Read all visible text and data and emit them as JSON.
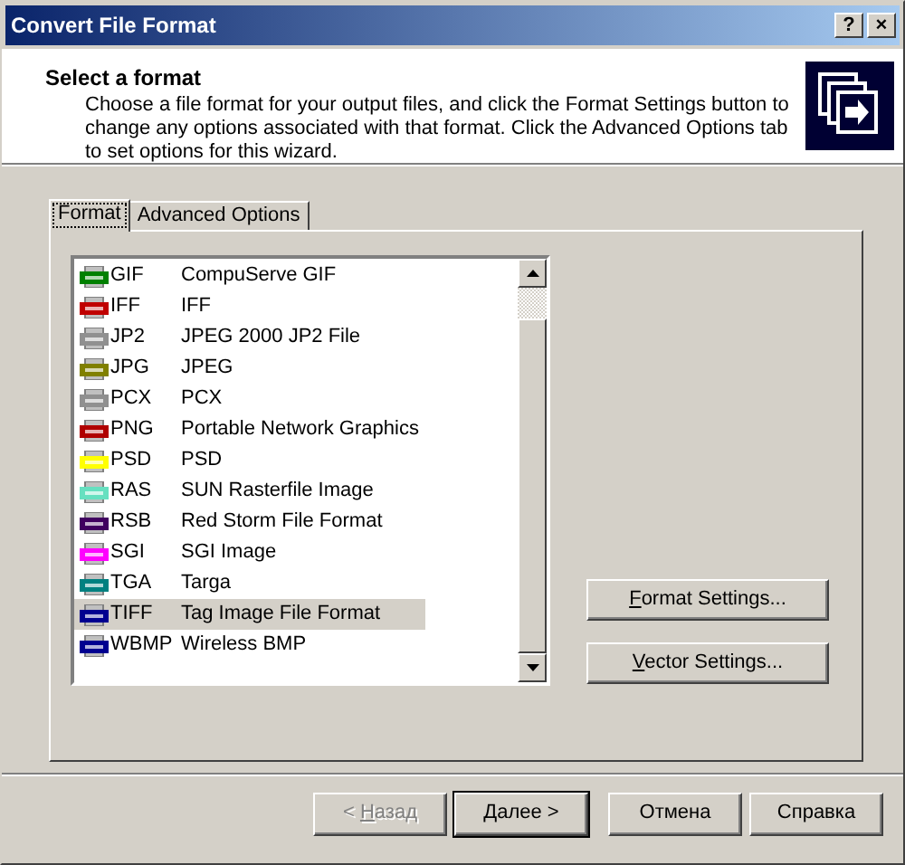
{
  "window": {
    "title": "Convert File Format",
    "title_buttons": [
      "?",
      "×"
    ]
  },
  "header": {
    "title": "Select a format",
    "description": "Choose a file format for your output files, and click the Format Settings button to change any options associated with that format. Click the Advanced Options tab to set options for this wizard."
  },
  "tabs": [
    {
      "label": "Format",
      "selected": true
    },
    {
      "label": "Advanced Options",
      "selected": false
    }
  ],
  "formats": [
    {
      "ext": "GIF",
      "name": "CompuServe GIF",
      "color": "#008000",
      "selected": false
    },
    {
      "ext": "IFF",
      "name": "IFF",
      "color": "#c00000",
      "selected": false
    },
    {
      "ext": "JP2",
      "name": "JPEG 2000 JP2 File",
      "color": "#909090",
      "selected": false
    },
    {
      "ext": "JPG",
      "name": "JPEG",
      "color": "#808000",
      "selected": false
    },
    {
      "ext": "PCX",
      "name": "PCX",
      "color": "#909090",
      "selected": false
    },
    {
      "ext": "PNG",
      "name": "Portable Network Graphics",
      "color": "#b00000",
      "selected": false
    },
    {
      "ext": "PSD",
      "name": "PSD",
      "color": "#ffff00",
      "selected": false
    },
    {
      "ext": "RAS",
      "name": "SUN Rasterfile Image",
      "color": "#66e0c0",
      "selected": false
    },
    {
      "ext": "RSB",
      "name": "Red Storm File Format",
      "color": "#400060",
      "selected": false
    },
    {
      "ext": "SGI",
      "name": "SGI Image",
      "color": "#ff00ff",
      "selected": false
    },
    {
      "ext": "TGA",
      "name": "Targa",
      "color": "#008080",
      "selected": false
    },
    {
      "ext": "TIFF",
      "name": "Tag Image File Format",
      "color": "#000090",
      "selected": true
    },
    {
      "ext": "WBMP",
      "name": "Wireless BMP",
      "color": "#000090",
      "selected": false
    }
  ],
  "side_buttons": [
    {
      "accel": "F",
      "after": "ormat Settings..."
    },
    {
      "accel": "V",
      "after": "ector Settings..."
    }
  ],
  "footer_buttons": [
    {
      "before": "< ",
      "accel": "Н",
      "after": "азад",
      "disabled": true,
      "default": false
    },
    {
      "accel": "Д",
      "after": "алее >",
      "disabled": false,
      "default": true
    },
    {
      "before": "Отмена",
      "disabled": false,
      "default": false
    },
    {
      "before": "Справка",
      "disabled": false,
      "default": false
    }
  ]
}
